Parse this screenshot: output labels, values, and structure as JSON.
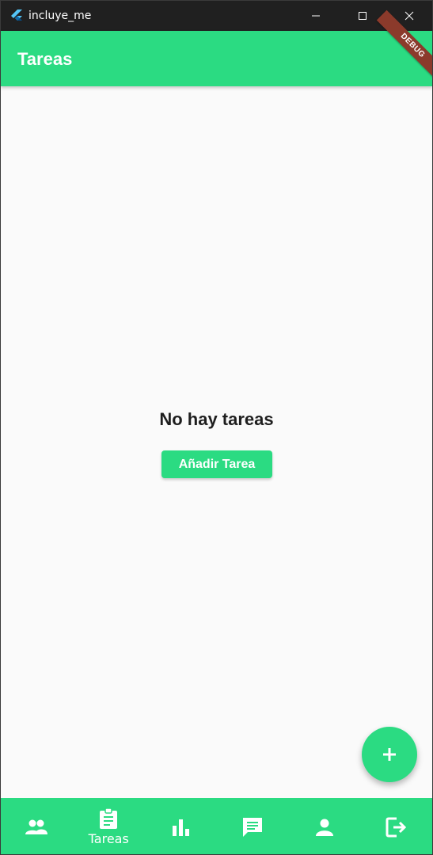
{
  "window": {
    "title": "incluye_me"
  },
  "appbar": {
    "title": "Tareas",
    "debug_banner": "DEBUG"
  },
  "main": {
    "empty_message": "No hay tareas",
    "add_task_label": "Añadir Tarea"
  },
  "nav": {
    "items": [
      {
        "icon": "people-icon",
        "label": ""
      },
      {
        "icon": "assignment-icon",
        "label": "Tareas",
        "selected": true
      },
      {
        "icon": "bar-chart-icon",
        "label": ""
      },
      {
        "icon": "chat-icon",
        "label": ""
      },
      {
        "icon": "person-icon",
        "label": ""
      },
      {
        "icon": "logout-icon",
        "label": ""
      }
    ]
  },
  "fab": {
    "icon": "plus-icon"
  },
  "colors": {
    "primary": "#2bdb82",
    "titlebar": "#202020",
    "background": "#fafafa",
    "debug_ribbon": "#8b3a2b"
  }
}
